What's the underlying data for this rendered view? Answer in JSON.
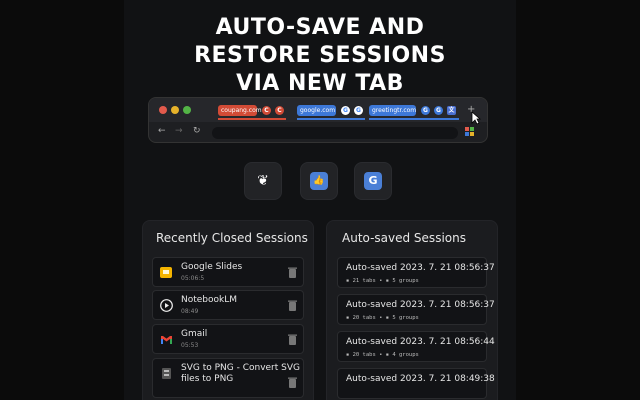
{
  "headline": {
    "line1": "AUTO-SAVE AND",
    "line2": "RESTORE SESSIONS",
    "line3": "VIA NEW TAB"
  },
  "browser": {
    "tab_groups": [
      {
        "label": "coupang.com",
        "color": "#d24b36"
      },
      {
        "label": "google.com",
        "color": "#3d78d8"
      },
      {
        "label": "greetingtr.com",
        "color": "#3d78d8"
      }
    ],
    "new_tab_glyph": "+",
    "back_glyph": "←",
    "forward_glyph": "→",
    "reload_glyph": "↻"
  },
  "quick_tiles": [
    {
      "icon": "brain-icon",
      "glyph": "❦"
    },
    {
      "icon": "thumb-up-icon",
      "glyph": "👍"
    },
    {
      "icon": "google-icon",
      "glyph": "G"
    }
  ],
  "recently_closed": {
    "title": "Recently Closed Sessions",
    "items": [
      {
        "title": "Google Slides",
        "time": "05:06:5",
        "icon": "google-slides-icon"
      },
      {
        "title": "NotebookLM",
        "time": "08:49",
        "icon": "notebooklm-icon"
      },
      {
        "title": "Gmail",
        "time": "05:53",
        "icon": "gmail-icon"
      },
      {
        "title": "SVG to PNG - Convert SVG",
        "title2": "files to PNG",
        "time": "",
        "icon": "svg-convert-icon"
      }
    ]
  },
  "auto_saved": {
    "title": "Auto-saved Sessions",
    "items": [
      {
        "title": "Auto-saved 2023. 7. 21 08:56:37",
        "tabs": "21 tabs",
        "groups": "5 groups"
      },
      {
        "title": "Auto-saved 2023. 7. 21 08:56:37",
        "tabs": "20 tabs",
        "groups": "5 groups"
      },
      {
        "title": "Auto-saved 2023. 7. 21 08:56:44",
        "tabs": "20 tabs",
        "groups": "4 groups"
      },
      {
        "title": "Auto-saved 2023. 7. 21 08:49:38",
        "tabs": "",
        "groups": ""
      }
    ],
    "separator": "•"
  }
}
